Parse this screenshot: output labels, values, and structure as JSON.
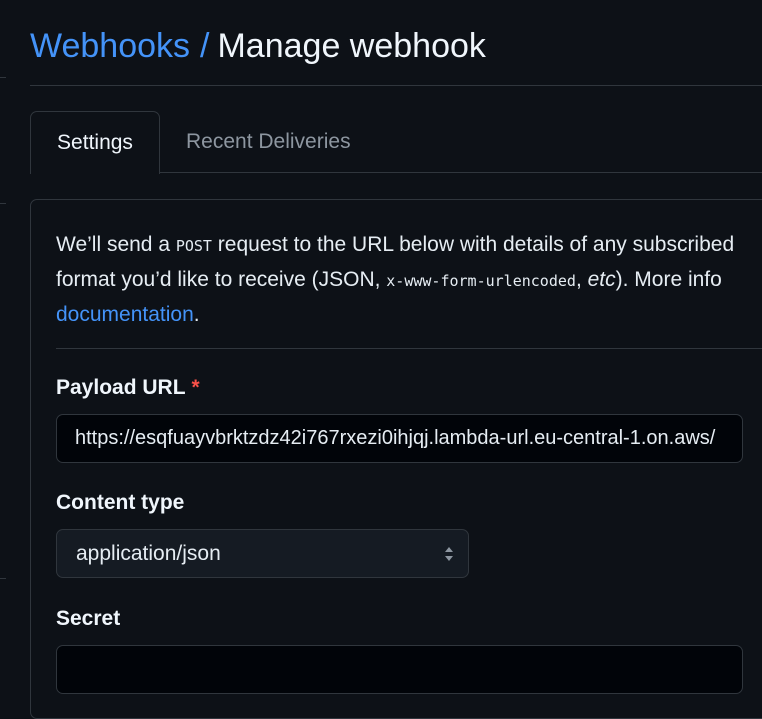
{
  "header": {
    "breadcrumb_link": "Webhooks",
    "separator": "/",
    "title": "Manage webhook"
  },
  "tabs": [
    {
      "label": "Settings",
      "active": true
    },
    {
      "label": "Recent Deliveries",
      "active": false
    }
  ],
  "intro": {
    "line1_a": "We’ll send a ",
    "line1_code": "POST",
    "line1_b": " request to the URL below with details of any subscribed",
    "line2_a": "format you’d like to receive (JSON, ",
    "line2_code": "x-www-form-urlencoded",
    "line2_b": ", ",
    "line2_em": "etc",
    "line2_c": "). More info",
    "line3_link": "documentation",
    "line3_end": "."
  },
  "payload_url": {
    "label": "Payload URL",
    "required_mark": "*",
    "value": "https://esqfuayvbrktzdz42i767rxezi0ihjqj.lambda-url.eu-central-1.on.aws/"
  },
  "content_type": {
    "label": "Content type",
    "selected": "application/json"
  },
  "secret": {
    "label": "Secret",
    "value": ""
  },
  "colors": {
    "background": "#0d1117",
    "accent_link": "#4493f8",
    "border": "#30363d",
    "required": "#f85149",
    "muted_text": "#8d96a0"
  },
  "icons": {
    "select_arrows": "chevron-up-down-icon"
  }
}
